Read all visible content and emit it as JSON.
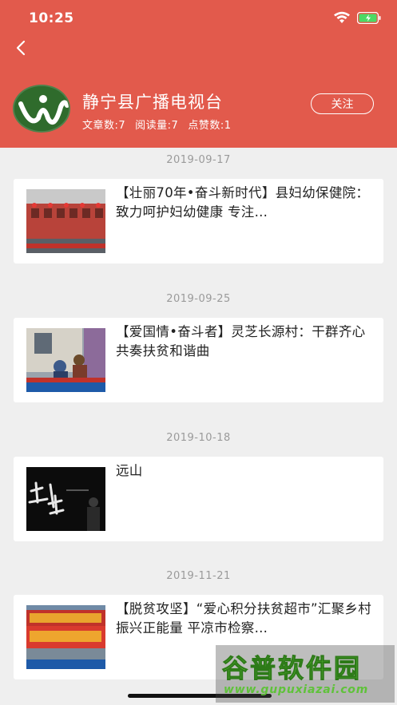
{
  "status_bar": {
    "time": "10:25",
    "wifi_icon": "wifi-icon",
    "battery_icon": "battery-charging-icon"
  },
  "header": {
    "back_icon": "chevron-left-icon",
    "channel_name": "静宁县广播电视台",
    "stats": {
      "articles": "文章数:7",
      "reads": "阅读量:7",
      "likes": "点赞数:1"
    },
    "follow_label": "关注",
    "colors": {
      "background": "#e25a4c",
      "text": "#ffffff"
    }
  },
  "feed": [
    {
      "date": "2019-09-17",
      "title": "【壮丽70年•奋斗新时代】县妇幼保健院：致力呵护妇幼健康 专注…"
    },
    {
      "date": "2019-09-25",
      "title": "【爱国情•奋斗者】灵芝长源村：干群齐心 共奏扶贫和谐曲"
    },
    {
      "date": "2019-10-18",
      "title": "远山"
    },
    {
      "date": "2019-11-21",
      "title": "【脱贫攻坚】“爱心积分扶贫超市”汇聚乡村振兴正能量 平凉市检察…"
    }
  ],
  "watermark": {
    "main": "谷普软件园",
    "url": "www.gupuxiazai.com"
  }
}
